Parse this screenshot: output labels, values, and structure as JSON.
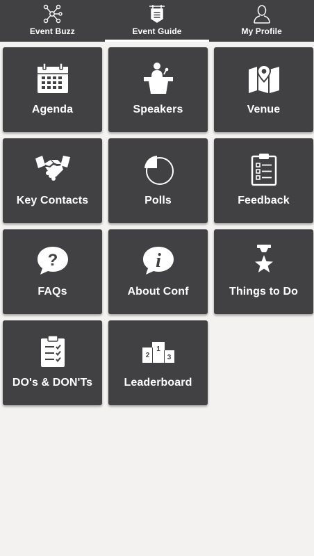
{
  "tabs": [
    {
      "label": "Event Buzz",
      "icon": "network-icon",
      "active": false
    },
    {
      "label": "Event Guide",
      "icon": "signboard-icon",
      "active": true
    },
    {
      "label": "My Profile",
      "icon": "user-icon",
      "active": false
    }
  ],
  "tiles": [
    {
      "label": "Agenda",
      "icon": "calendar-icon"
    },
    {
      "label": "Speakers",
      "icon": "podium-speaker-icon"
    },
    {
      "label": "Venue",
      "icon": "map-pin-icon"
    },
    {
      "label": "Key Contacts",
      "icon": "handshake-icon"
    },
    {
      "label": "Polls",
      "icon": "pie-chart-icon"
    },
    {
      "label": "Feedback",
      "icon": "clipboard-checklist-icon"
    },
    {
      "label": "FAQs",
      "icon": "question-bubble-icon"
    },
    {
      "label": "About Conf",
      "icon": "info-bubble-icon"
    },
    {
      "label": "Things to Do",
      "icon": "star-attraction-icon"
    },
    {
      "label": "DO's & DON'Ts",
      "icon": "checklist-icon"
    },
    {
      "label": "Leaderboard",
      "icon": "winners-podium-icon"
    }
  ],
  "leaderboard_ranks": [
    "1",
    "2",
    "3"
  ],
  "colors": {
    "bar_background": "#414042",
    "tile_background": "#414042",
    "page_background": "#f3f2f0",
    "text": "#ffffff"
  }
}
